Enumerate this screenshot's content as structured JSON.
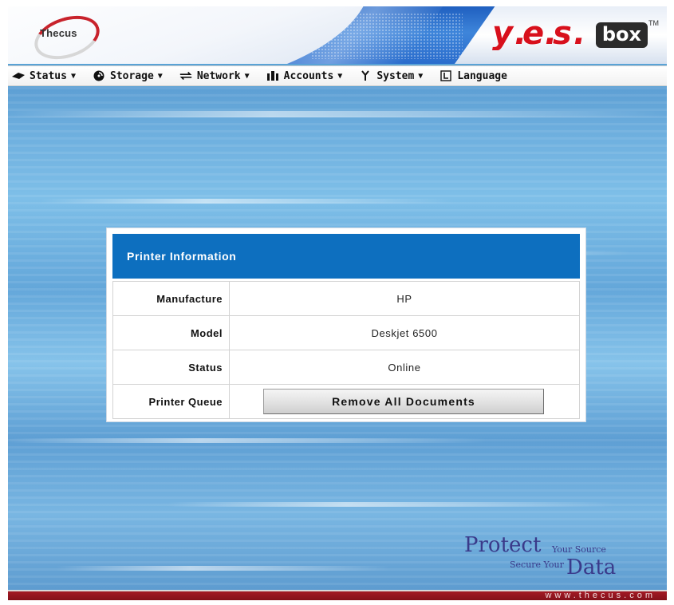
{
  "brand": {
    "left_logo": "Thecus",
    "right_logo_text": "yes",
    "right_logo_box": "box",
    "right_logo_tm": "TM"
  },
  "menu": [
    {
      "label": "Status",
      "icon": "status-icon",
      "has_dropdown": true
    },
    {
      "label": "Storage",
      "icon": "storage-disc-icon",
      "has_dropdown": true
    },
    {
      "label": "Network",
      "icon": "network-arrows-icon",
      "has_dropdown": true
    },
    {
      "label": "Accounts",
      "icon": "accounts-users-icon",
      "has_dropdown": true
    },
    {
      "label": "System",
      "icon": "system-tool-icon",
      "has_dropdown": true
    },
    {
      "label": "Language",
      "icon": "language-icon",
      "has_dropdown": false
    }
  ],
  "printer": {
    "title": "Printer Information",
    "rows": [
      {
        "label": "Manufacture",
        "value": "HP"
      },
      {
        "label": "Model",
        "value": "Deskjet 6500"
      },
      {
        "label": "Status",
        "value": "Online"
      }
    ],
    "queue_label": "Printer Queue",
    "remove_button": "Remove All Documents"
  },
  "slogan": {
    "word1": "Protect",
    "line1": "Your Source",
    "line2": "Secure Your",
    "word2": "Data"
  },
  "footer": {
    "url": "www.thecus.com"
  },
  "colors": {
    "panel_header": "#0d6fbf",
    "footer": "#8b1520",
    "logo_red": "#d8101c"
  }
}
